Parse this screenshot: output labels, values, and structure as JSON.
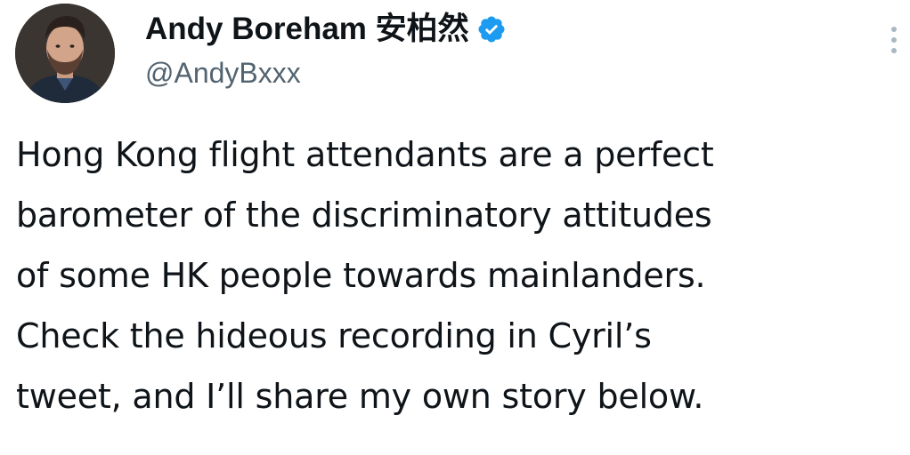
{
  "author": {
    "display_name": "Andy Boreham 安柏然",
    "handle": "@AndyBxxx",
    "verified": true,
    "avatar_icon": "profile-photo"
  },
  "tweet": {
    "lines": [
      "Hong Kong flight attendants are a perfect",
      "barometer of the discriminatory attitudes",
      "of some HK people towards mainlanders.",
      "Check the hideous recording in Cyril’s",
      "tweet, and I’ll share my own story below."
    ]
  },
  "icons": {
    "verified": "verified-badge-icon",
    "more": "more-options-icon"
  },
  "colors": {
    "text": "#0f1419",
    "secondary_text": "#536471",
    "verified_badge": "#1d9bf0"
  }
}
